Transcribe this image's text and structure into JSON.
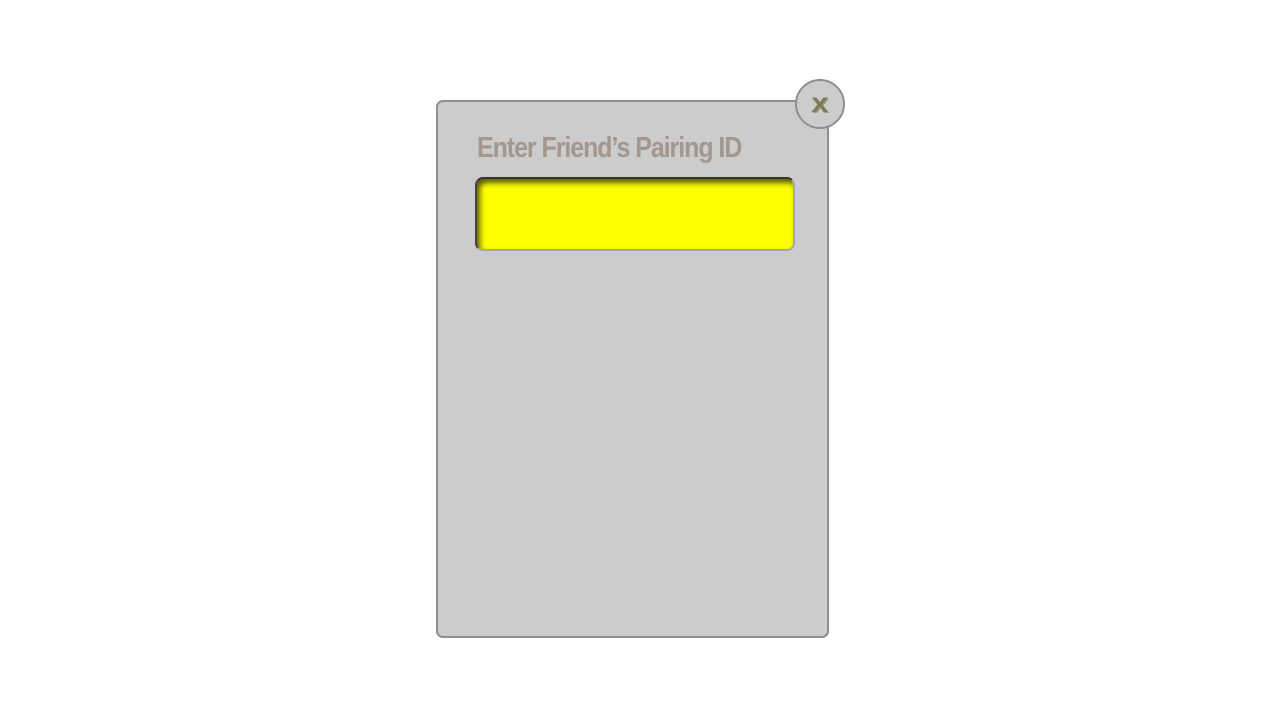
{
  "dialog": {
    "title": "Enter Friend’s Pairing ID",
    "input": {
      "value": "",
      "placeholder": ""
    },
    "close_label": "x"
  },
  "colors": {
    "page_background": "#ffffff",
    "dialog_background": "#cccccc",
    "dialog_border": "#8f8f8f",
    "title_text": "#a39790",
    "input_background": "#ffff00",
    "close_icon": "#7d7d57"
  },
  "icons": {
    "close": "close-icon"
  }
}
